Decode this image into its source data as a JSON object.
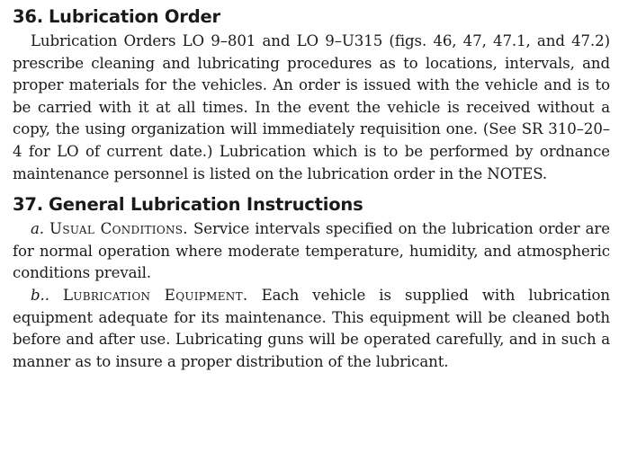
{
  "sections": [
    {
      "number": "36.",
      "title": "Lubrication Order",
      "paragraph": "Lubrication Orders LO 9–801 and LO 9–U315 (figs. 46, 47, 47.1, and 47.2) prescribe cleaning and lubricating procedures as to locations, intervals, and proper materials for the vehicles. An order is issued with the vehicle and is to be carried with it at all times. In the event the vehicle is received without a copy, the using organization will immediately requisition one. (See SR 310–20–4 for LO of current date.) Lubrication which is to be performed by ordnance maintenance personnel is listed on the lubrication order in the NOTES."
    },
    {
      "number": "37.",
      "title": "General Lubrication Instructions",
      "items": [
        {
          "marker": "a.",
          "caption": "Usual Conditions.",
          "text": "Service intervals specified on the lubrication order are for normal operation where moderate temperature, humidity, and atmospheric conditions prevail."
        },
        {
          "marker": "b..",
          "caption": "Lubrication Equipment.",
          "text": "Each vehicle is supplied with lubrication equipment adequate for its maintenance. This equipment will be cleaned both before and after use. Lubricating guns will be operated carefully, and in such a manner as to insure a proper distribution of the lubricant."
        }
      ]
    }
  ]
}
